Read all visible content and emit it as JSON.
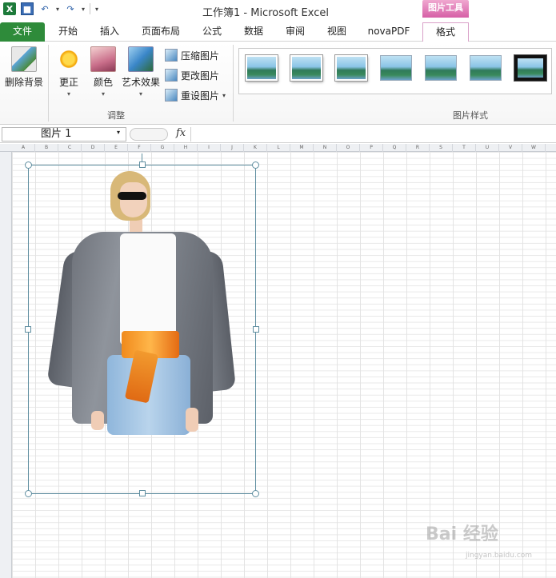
{
  "window": {
    "title": "工作簿1 - Microsoft Excel"
  },
  "qat": {
    "logo": "X",
    "save": "■",
    "undo": "↶",
    "redo": "↷",
    "caret": "▾"
  },
  "tabs": {
    "context_group": "图片工具",
    "items": [
      {
        "label": "文件"
      },
      {
        "label": "开始"
      },
      {
        "label": "插入"
      },
      {
        "label": "页面布局"
      },
      {
        "label": "公式"
      },
      {
        "label": "数据"
      },
      {
        "label": "审阅"
      },
      {
        "label": "视图"
      },
      {
        "label": "novaPDF"
      },
      {
        "label": "格式"
      }
    ]
  },
  "ribbon": {
    "adjust_group_label": "调整",
    "styles_group_label": "图片样式",
    "remove_background": "删除背景",
    "corrections": "更正",
    "color": "颜色",
    "artistic_effects": "艺术效果",
    "compress_pictures": "压缩图片",
    "change_picture": "更改图片",
    "reset_picture": "重设图片",
    "dropdown_caret": "▾"
  },
  "formula_bar": {
    "name_box": "图片 1",
    "fx": "fx",
    "caret": "▾"
  },
  "column_headers": [
    "A",
    "B",
    "C",
    "D",
    "E",
    "F",
    "G",
    "H",
    "I",
    "J",
    "K",
    "L",
    "M",
    "N",
    "O",
    "P",
    "Q",
    "R",
    "S",
    "T",
    "U",
    "V",
    "W"
  ],
  "watermark": {
    "text": "Bai 经验",
    "sub": "jingyan.baidu.com"
  },
  "colors": {
    "file_tab": "#2e8b3a",
    "context_tab": "#d65fa6",
    "selection": "#5f8ea0"
  }
}
